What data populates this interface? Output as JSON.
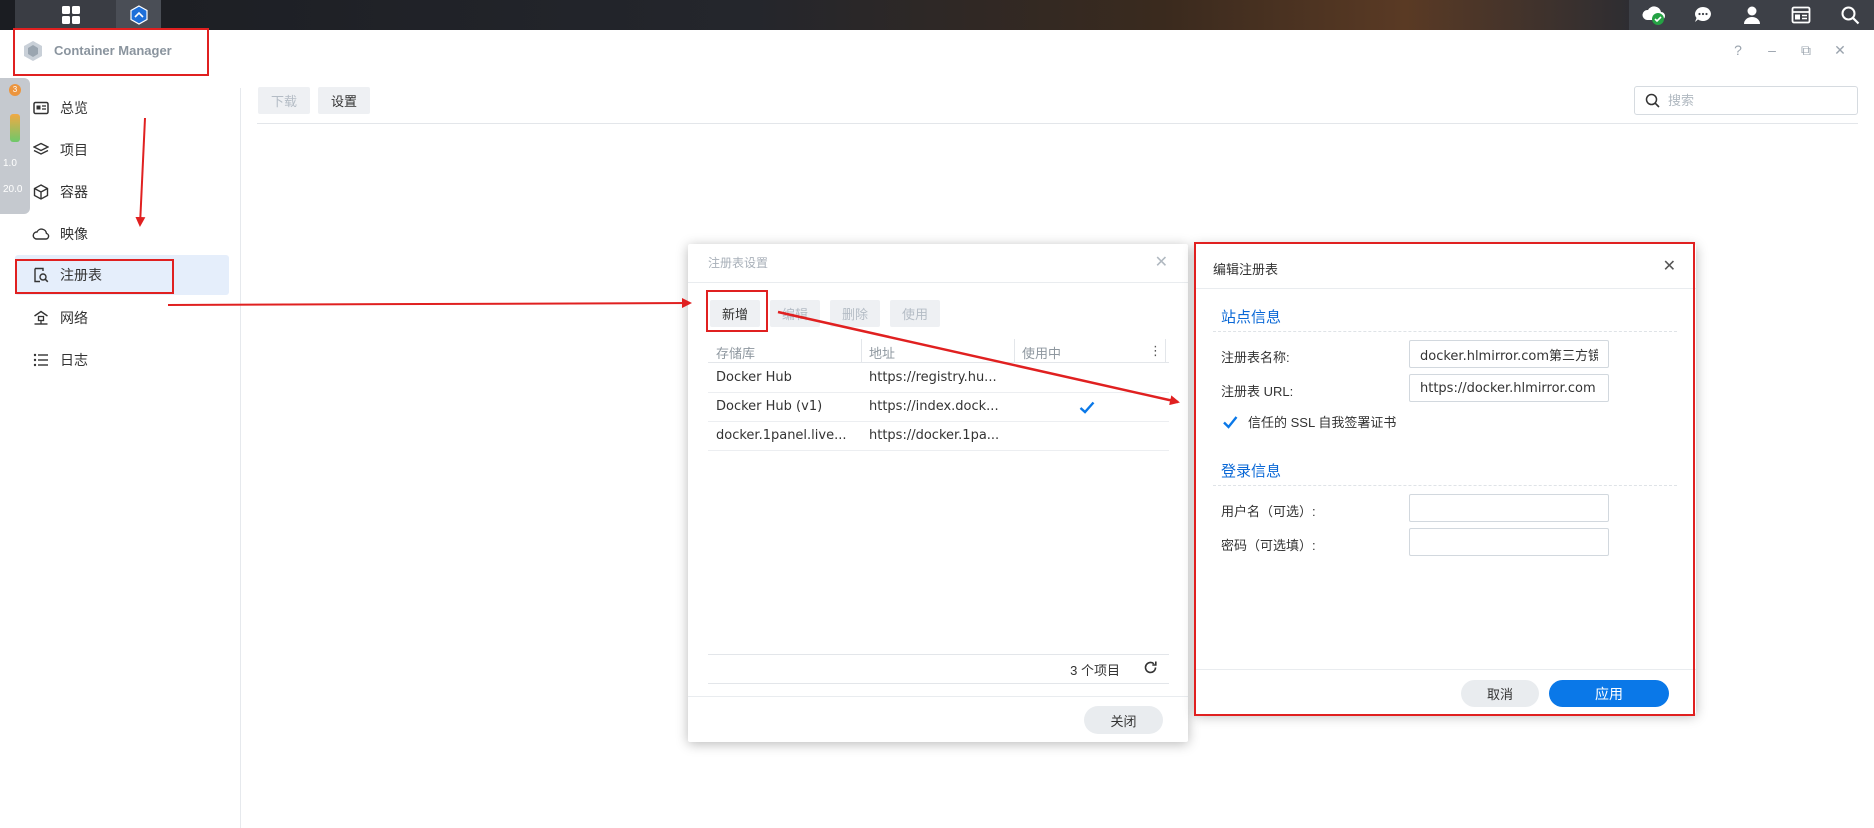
{
  "window": {
    "title": "Container Manager"
  },
  "widget": {
    "badge": "3",
    "speed_up": "1.0",
    "speed_down": "20.0"
  },
  "sidebar": {
    "items": [
      {
        "label": "总览",
        "icon": "overview-icon"
      },
      {
        "label": "项目",
        "icon": "layers-icon"
      },
      {
        "label": "容器",
        "icon": "cube-icon"
      },
      {
        "label": "映像",
        "icon": "cloud-icon"
      },
      {
        "label": "注册表",
        "icon": "registry-search-icon"
      },
      {
        "label": "网络",
        "icon": "network-icon"
      },
      {
        "label": "日志",
        "icon": "list-icon"
      }
    ]
  },
  "toolbar": {
    "download_label": "下载",
    "settings_label": "设置",
    "search_placeholder": "搜索"
  },
  "registry_settings": {
    "title": "注册表设置",
    "buttons": {
      "add": "新增",
      "edit": "编辑",
      "delete": "删除",
      "use": "使用"
    },
    "columns": [
      "存储库",
      "地址",
      "使用中"
    ],
    "rows": [
      {
        "repo": "Docker Hub",
        "address": "https://registry.hu...",
        "in_use": false
      },
      {
        "repo": "Docker Hub (v1)",
        "address": "https://index.dock...",
        "in_use": true
      },
      {
        "repo": "docker.1panel.live...",
        "address": "https://docker.1pa...",
        "in_use": false
      }
    ],
    "count_text": "3 个项目",
    "close_label": "关闭"
  },
  "edit_registry": {
    "title": "编辑注册表",
    "site_section": "站点信息",
    "name_label": "注册表名称:",
    "name_value": "docker.hlmirror.com第三方镜",
    "url_label": "注册表 URL:",
    "url_value": "https://docker.hlmirror.com",
    "ssl_label": "信任的 SSL 自我签署证书",
    "ssl_checked": true,
    "login_section": "登录信息",
    "user_label": "用户名（可选）:",
    "user_value": "",
    "pass_label": "密码（可选填）:",
    "pass_value": "",
    "cancel_label": "取消",
    "apply_label": "应用"
  },
  "colors": {
    "accent": "#0a78e8",
    "annotation": "#e02020",
    "sidebar_active": "#e5eefb"
  }
}
